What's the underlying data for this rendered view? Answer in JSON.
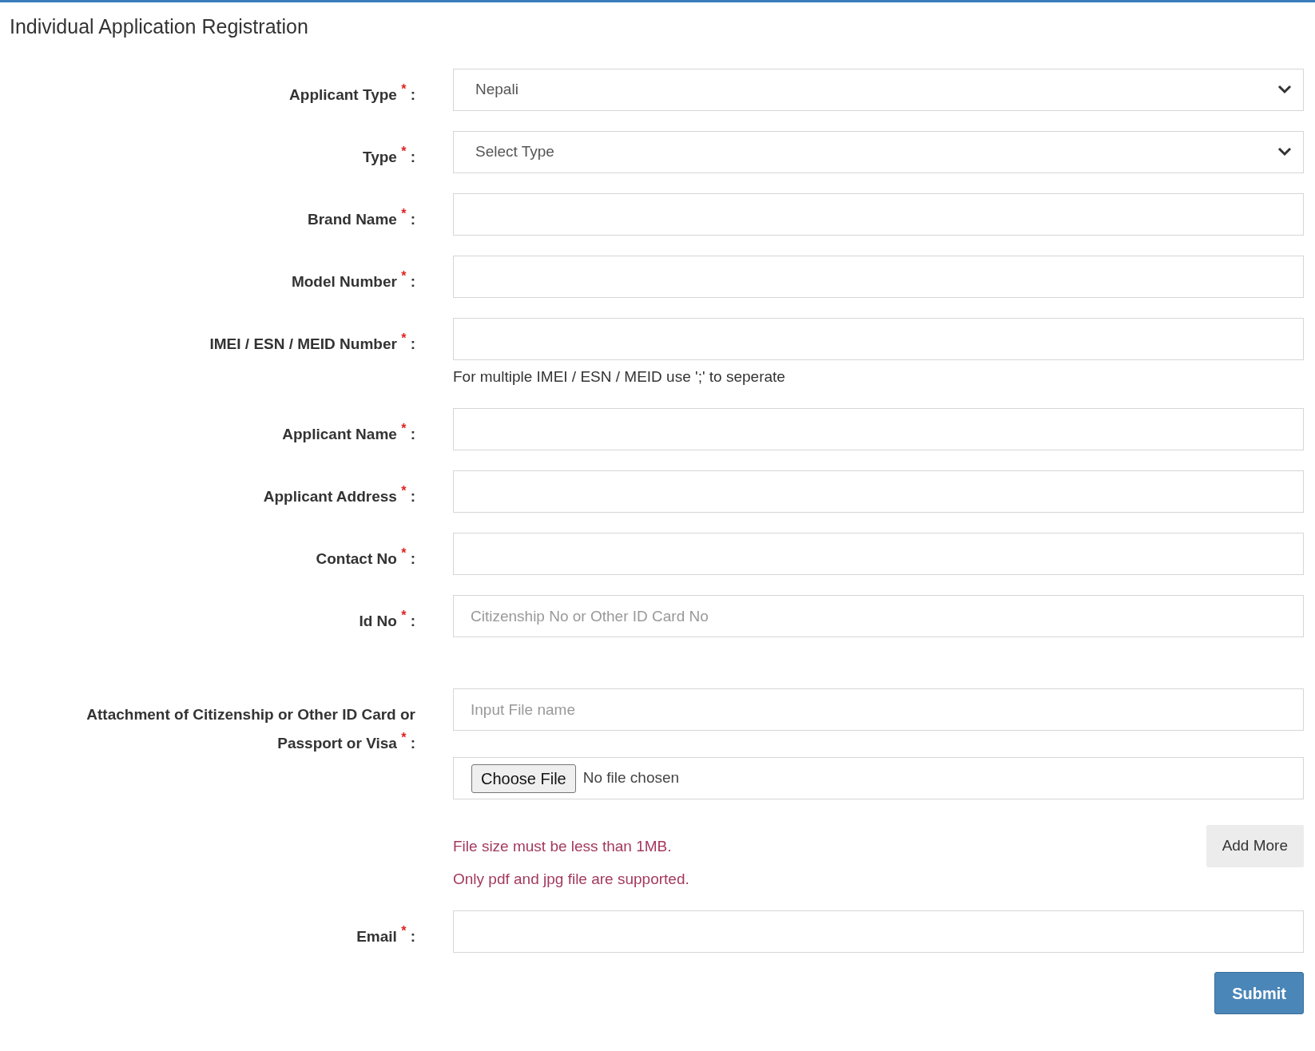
{
  "title": "Individual Application Registration",
  "rows": [
    {
      "label": "Applicant Type",
      "required_mark": "*",
      "separator": ":",
      "controls": [
        {
          "kind": "select",
          "value": "Nepali"
        }
      ]
    },
    {
      "label": "Type",
      "required_mark": "*",
      "separator": ":",
      "controls": [
        {
          "kind": "select",
          "value": "Select Type"
        }
      ]
    },
    {
      "label": "Brand Name",
      "required_mark": "*",
      "separator": ":",
      "controls": [
        {
          "kind": "text"
        }
      ]
    },
    {
      "label": "Model Number",
      "required_mark": "*",
      "separator": ":",
      "controls": [
        {
          "kind": "text"
        }
      ]
    },
    {
      "label": "IMEI / ESN / MEID Number",
      "required_mark": "*",
      "separator": ":",
      "controls": [
        {
          "kind": "text"
        }
      ],
      "help": "For multiple IMEI / ESN / MEID use ';' to seperate"
    },
    {
      "label": "Applicant Name",
      "required_mark": "*",
      "separator": ":",
      "controls": [
        {
          "kind": "text"
        }
      ]
    },
    {
      "label": "Applicant Address",
      "required_mark": "*",
      "separator": ":",
      "controls": [
        {
          "kind": "text"
        }
      ]
    },
    {
      "label": "Contact No",
      "required_mark": "*",
      "separator": ":",
      "controls": [
        {
          "kind": "text"
        }
      ]
    },
    {
      "label": "Id No",
      "required_mark": "*",
      "separator": ":",
      "controls": [
        {
          "kind": "text",
          "placeholder": "Citizenship No or Other ID Card No"
        }
      ]
    },
    {
      "label": "Attachment of Citizenship or Other ID Card or Passport or Visa",
      "required_mark": "*",
      "separator": ":",
      "controls": [
        {
          "kind": "text",
          "placeholder": "Input File name"
        },
        {
          "kind": "file",
          "button": "Choose File",
          "status": "No file chosen"
        }
      ],
      "notes": [
        "File size must be less than 1MB.",
        "Only pdf and jpg file are supported."
      ],
      "add_more": "Add More"
    },
    {
      "label": "Email",
      "required_mark": "*",
      "separator": ":",
      "controls": [
        {
          "kind": "text"
        }
      ]
    }
  ],
  "submit": "Submit"
}
